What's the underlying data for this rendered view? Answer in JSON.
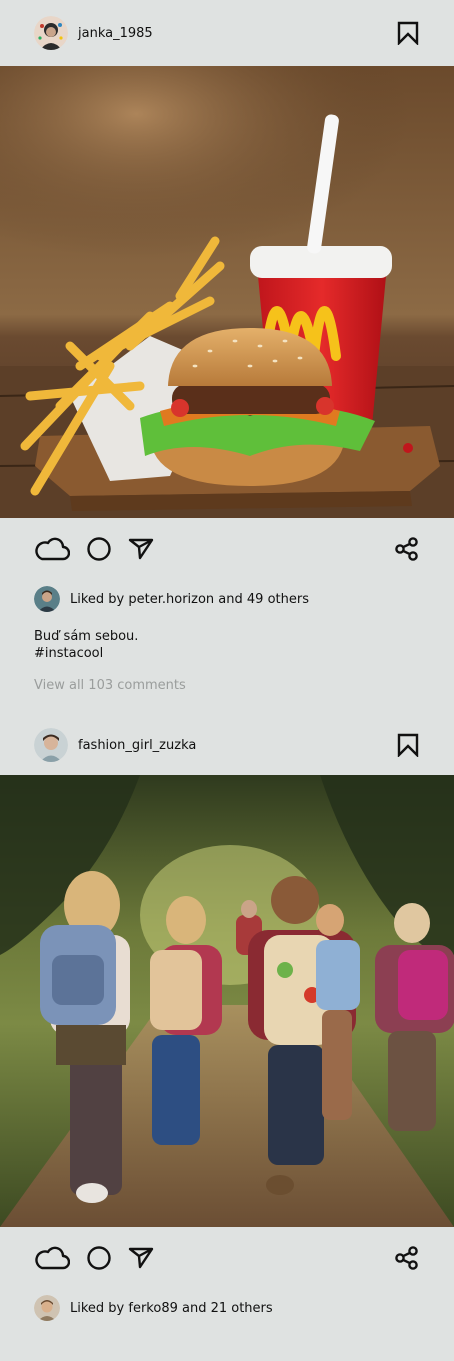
{
  "posts": [
    {
      "username": "janka_1985",
      "likes_text": "Liked by peter.horizon and 49 others",
      "caption_line1": "Buď sám sebou.",
      "caption_line2": "#instacool",
      "comments_link": "View all 103 comments",
      "photo_alt": "McDonald's burger, fries and drink"
    },
    {
      "username": "fashion_girl_zuzka",
      "likes_text": "Liked by ferko89 and 21 others",
      "photo_alt": "Children with backpacks walking on a forest path"
    }
  ],
  "icons": {
    "bookmark": "bookmark-icon",
    "like": "cloud-icon",
    "comment": "circle-icon",
    "send": "send-icon",
    "share": "share-icon"
  }
}
